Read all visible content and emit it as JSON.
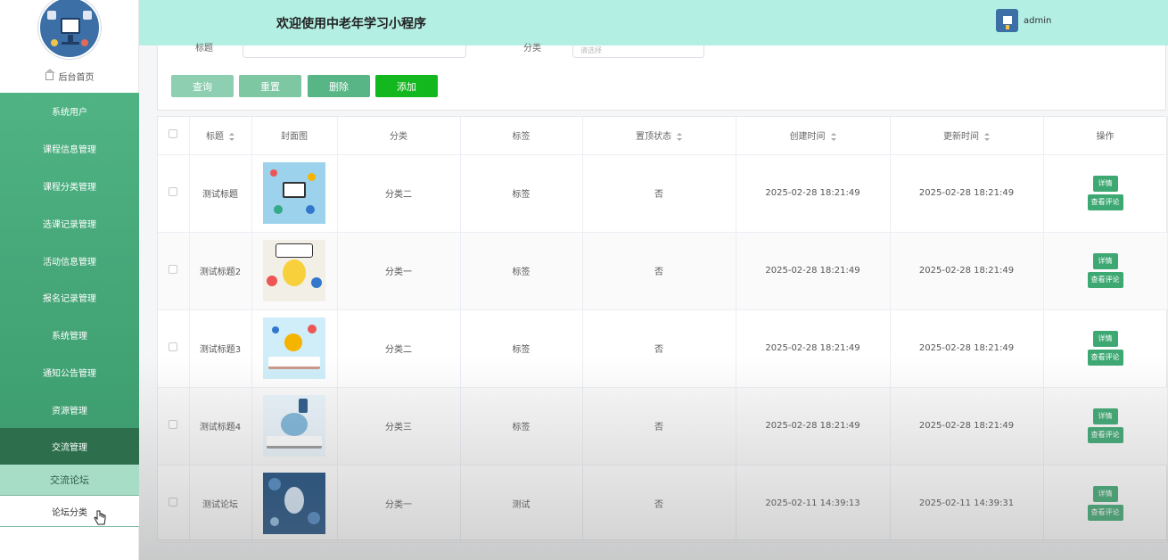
{
  "header": {
    "title": "欢迎使用中老年学习小程序",
    "username": "admin"
  },
  "sidebar": {
    "home_label": "后台首页",
    "items": [
      "系统用户",
      "课程信息管理",
      "课程分类管理",
      "选课记录管理",
      "活动信息管理",
      "报名记录管理",
      "系统管理",
      "通知公告管理",
      "资源管理"
    ],
    "active_group": "交流管理",
    "sub_items": [
      "交流论坛",
      "论坛分类"
    ]
  },
  "search": {
    "title_label": "标题",
    "category_label": "分类",
    "category_placeholder": "请选择",
    "buttons": {
      "query": "查询",
      "reset": "重置",
      "delete": "删除",
      "add": "添加"
    }
  },
  "table": {
    "headers": [
      "标题",
      "封面图",
      "分类",
      "标签",
      "置顶状态",
      "创建时间",
      "更新时间",
      "操作"
    ],
    "rows": [
      {
        "title": "测试标题",
        "category": "分类二",
        "tag": "标签",
        "pinned": "否",
        "created": "2025-02-28 18:21:49",
        "updated": "2025-02-28 18:21:49"
      },
      {
        "title": "测试标题2",
        "category": "分类一",
        "tag": "标签",
        "pinned": "否",
        "created": "2025-02-28 18:21:49",
        "updated": "2025-02-28 18:21:49"
      },
      {
        "title": "测试标题3",
        "category": "分类二",
        "tag": "标签",
        "pinned": "否",
        "created": "2025-02-28 18:21:49",
        "updated": "2025-02-28 18:21:49"
      },
      {
        "title": "测试标题4",
        "category": "分类三",
        "tag": "标签",
        "pinned": "否",
        "created": "2025-02-28 18:21:49",
        "updated": "2025-02-28 18:21:49"
      },
      {
        "title": "测试论坛",
        "category": "分类一",
        "tag": "测试",
        "pinned": "否",
        "created": "2025-02-11 14:39:13",
        "updated": "2025-02-11 14:39:31"
      }
    ],
    "op_detail": "详情",
    "op_comments": "查看评论"
  },
  "colors": {
    "header_bg": "#b3efe3",
    "menu_bg": "#4fb383",
    "active_bg": "#2d6f4c",
    "add_button": "#13b71e"
  }
}
